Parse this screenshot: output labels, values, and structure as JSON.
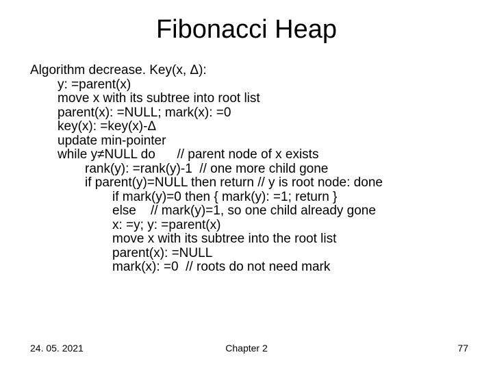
{
  "title": "Fibonacci Heap",
  "algo": {
    "header": "Algorithm decrease. Key(x, Δ):",
    "l1": "y: =parent(x)",
    "l2": "move x with its subtree into root list",
    "l3": "parent(x): =NULL; mark(x): =0",
    "l4": "key(x): =key(x)-Δ",
    "l5": "update min-pointer",
    "l6": "while y≠NULL do      // parent node of x exists",
    "l7": "rank(y): =rank(y)-1  // one more child gone",
    "l8": "if parent(y)=NULL then return // y is root node: done",
    "l9": "if mark(y)=0 then { mark(y): =1; return }",
    "l10": "else    // mark(y)=1, so one child already gone",
    "l11": "x: =y; y: =parent(x)",
    "l12": "move x with its subtree into the root list",
    "l13": "parent(x): =NULL",
    "l14": "mark(x): =0  // roots do not need mark"
  },
  "footer": {
    "date": "24. 05. 2021",
    "chapter": "Chapter 2",
    "page": "77"
  }
}
